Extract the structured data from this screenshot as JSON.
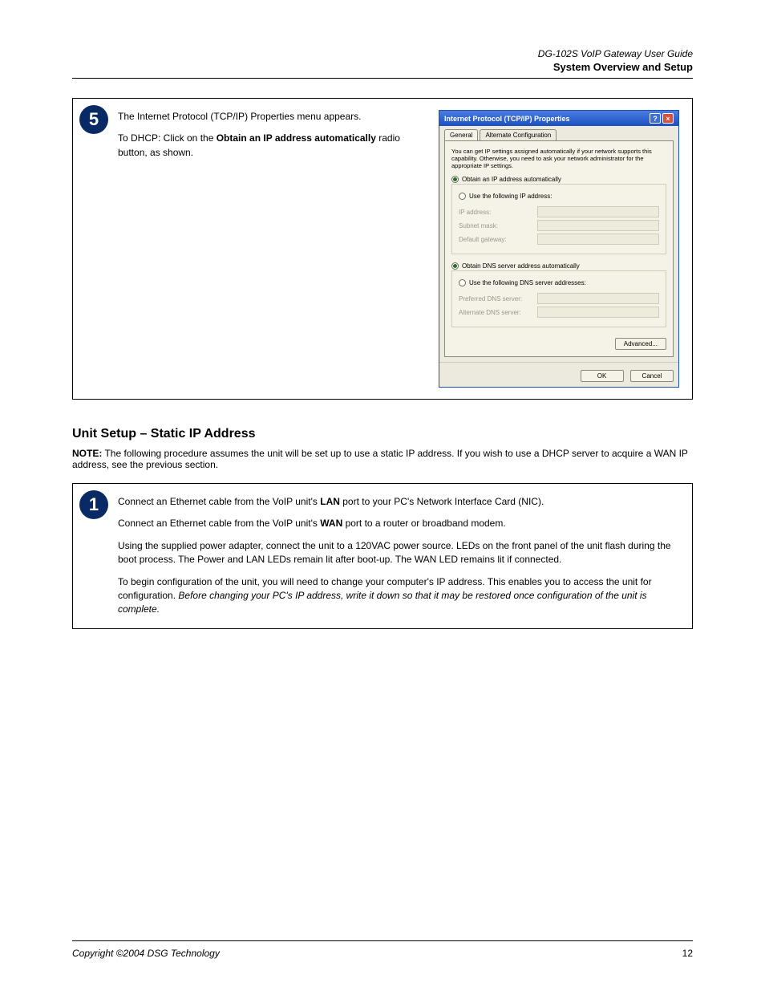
{
  "header": {
    "doc_title": "DG-102S VoIP Gateway User Guide",
    "section_title": "System Overview and Setup"
  },
  "step5": {
    "badge": "5",
    "text": {
      "p1": "The Internet Protocol (TCP/IP) Properties menu appears.",
      "p2_a": "To DHCP: Click on the ",
      "p2_b": "Obtain an IP address automatically",
      "p2_c": " radio button, as shown."
    },
    "dialog": {
      "title": "Internet Protocol (TCP/IP) Properties",
      "help_btn": "?",
      "close_btn": "×",
      "tabs": {
        "general": "General",
        "alt": "Alternate Configuration"
      },
      "desc": "You can get IP settings assigned automatically if your network supports this capability. Otherwise, you need to ask your network administrator for the appropriate IP settings.",
      "radios": {
        "ip_auto": "Obtain an IP address automatically",
        "ip_manual": "Use the following IP address:",
        "dns_auto": "Obtain DNS server address automatically",
        "dns_manual": "Use the following DNS server addresses:"
      },
      "fields": {
        "ip": "IP address:",
        "mask": "Subnet mask:",
        "gw": "Default gateway:",
        "pdns": "Preferred DNS server:",
        "adns": "Alternate DNS server:"
      },
      "buttons": {
        "advanced": "Advanced...",
        "ok": "OK",
        "cancel": "Cancel"
      }
    }
  },
  "section2": {
    "heading": "Unit Setup – Static IP Address",
    "note_label": "NOTE:",
    "note_text": " The following procedure assumes the unit will be set up to use a static IP address. If you wish to use a DHCP server to acquire a WAN IP address, see the previous section.",
    "step1": {
      "badge": "1",
      "p1_a": "Connect an Ethernet cable from the VoIP unit's ",
      "p1_b": "LAN",
      "p1_c": " port to your PC's Network Interface Card (NIC).",
      "p2_a": "Connect an Ethernet cable from the VoIP unit's ",
      "p2_b": "WAN",
      "p2_c": " port to a router or broadband modem.",
      "p3": "Using the supplied power adapter, connect the unit to a 120VAC power source. LEDs on the front panel of the unit flash during the boot process. The Power and LAN LEDs remain lit after boot-up. The WAN LED remains lit if connected.",
      "p4_a": "To begin configuration of the unit, you will need to change your computer's IP address. This enables you to access the unit for configuration. ",
      "p4_b": "Before changing your PC's IP address, write it down so that it may be restored once configuration of the unit is complete."
    }
  },
  "footer": {
    "copy": "Copyright ©2004 DSG Technology",
    "page": "12"
  }
}
